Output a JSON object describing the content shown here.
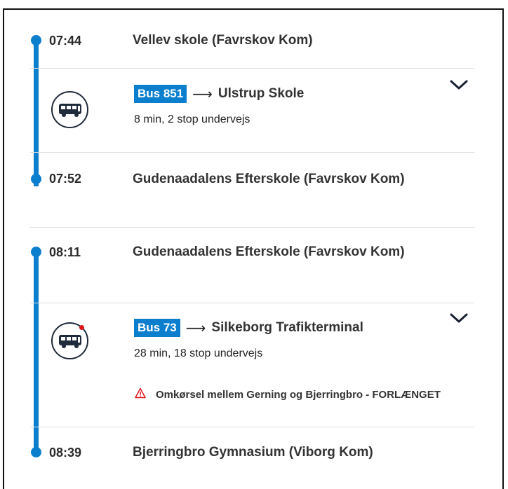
{
  "legs": [
    {
      "departure": {
        "time": "07:44",
        "stop": "Vellev skole (Favrskov Kom)"
      },
      "vehicle": {
        "icon": "bus-icon",
        "line": "Bus 851",
        "arrow": "⟶",
        "destination": "Ulstrup Skole",
        "details": "8 min, 2 stop undervejs"
      },
      "arrival": {
        "time": "07:52",
        "stop": "Gudenaadalens Efterskole (Favrskov Kom)"
      }
    },
    {
      "departure": {
        "time": "08:11",
        "stop": "Gudenaadalens Efterskole (Favrskov Kom)"
      },
      "vehicle": {
        "icon": "bus-icon",
        "has_alert": true,
        "line": "Bus 73",
        "arrow": "⟶",
        "destination": "Silkeborg Trafikterminal",
        "details": "28 min, 18 stop undervejs"
      },
      "warning": {
        "icon": "warning-triangle-icon",
        "text": "Omkørsel mellem Gerning og Bjerringbro - FORLÆNGET"
      },
      "arrival": {
        "time": "08:39",
        "stop": "Bjerringbro Gymnasium (Viborg Kom)"
      }
    }
  ],
  "colors": {
    "accent": "#0b7fce",
    "alert": "#e0151c",
    "text": "#333333",
    "divider": "#dedede"
  }
}
